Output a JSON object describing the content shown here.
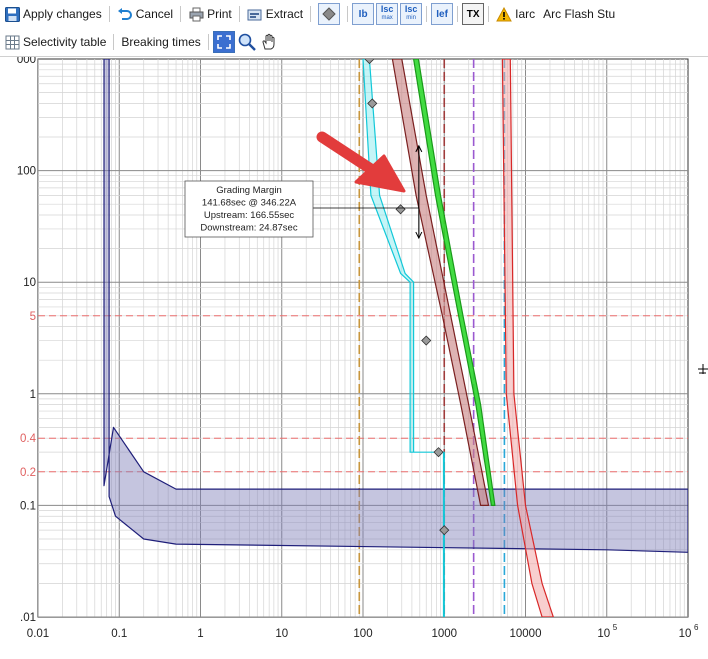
{
  "toolbar": {
    "apply_label": "Apply changes",
    "cancel_label": "Cancel",
    "print_label": "Print",
    "extract_label": "Extract",
    "ib_label": "Ib",
    "isc_label": "Isc",
    "isc_max_sub": "max",
    "isc_min_sub": "min",
    "ief_label": "Ief",
    "tx_label": "TX",
    "iarc_label": "Iarc",
    "arcflash_label": "Arc Flash Stu",
    "selectivity_label": "Selectivity table",
    "breaking_label": "Breaking times"
  },
  "icons": [
    "save-icon",
    "undo-icon",
    "printer-icon",
    "extract-icon",
    "diamond-icon",
    "warning-icon",
    "grid-table-icon",
    "zoom-extents-icon",
    "zoom-magnifier-icon",
    "pan-hand-icon"
  ],
  "chart_data": {
    "type": "line",
    "xscale": "log",
    "yscale": "log",
    "xlim": [
      0.01,
      1000000
    ],
    "ylim": [
      0.01,
      1000
    ],
    "grid": true,
    "x_tick_labels": [
      "0.01",
      "0.1",
      "1",
      "10",
      "100",
      "1000",
      "10000",
      "10^5",
      "10^6"
    ],
    "y_tick_labels": [
      "000",
      "100",
      "10",
      "5",
      "1",
      "0.4",
      "0.2",
      "0.1",
      ".01"
    ],
    "reference_lines": {
      "horizontal": [
        5,
        0.4,
        0.2
      ],
      "vertical": [
        {
          "x": 90,
          "color": "#c8963c",
          "style": "dashed"
        },
        {
          "x": 1000,
          "color": "#a03c3c",
          "style": "dashed"
        },
        {
          "x": 2300,
          "color": "#9b59d0",
          "style": "dashed"
        },
        {
          "x": 5500,
          "color": "#29a8d8",
          "style": "dashed"
        }
      ]
    },
    "series": [
      {
        "fill": "#7f7fb8",
        "stroke": "#1f1f7a",
        "opacity": 0.45,
        "upper": [
          [
            0.065,
            1000
          ],
          [
            0.065,
            0.15
          ],
          [
            0.085,
            0.5
          ],
          [
            0.2,
            0.2
          ],
          [
            0.5,
            0.14
          ],
          [
            1000000,
            0.14
          ]
        ],
        "lower": [
          [
            0.075,
            1000
          ],
          [
            0.075,
            0.12
          ],
          [
            0.09,
            0.08
          ],
          [
            0.2,
            0.05
          ],
          [
            0.5,
            0.045
          ],
          [
            100000,
            0.04
          ],
          [
            1000000,
            0.038
          ]
        ]
      },
      {
        "fill": "#7fe8ee",
        "stroke": "#12c8d8",
        "opacity": 0.45,
        "upper": [
          [
            120,
            1000
          ],
          [
            160,
            60
          ],
          [
            330,
            12
          ],
          [
            420,
            10
          ],
          [
            420,
            0.3
          ],
          [
            1000,
            0.3
          ],
          [
            1000,
            0.01
          ]
        ],
        "lower": [
          [
            100,
            1000
          ],
          [
            125,
            60
          ],
          [
            290,
            12
          ],
          [
            380,
            10
          ],
          [
            380,
            0.3
          ],
          [
            980,
            0.3
          ],
          [
            980,
            0.01
          ]
        ]
      },
      {
        "fill": "#c88080",
        "stroke": "#7a2020",
        "opacity": 0.6,
        "upper": [
          [
            300,
            1000
          ],
          [
            600,
            60
          ],
          [
            1200,
            5
          ],
          [
            2000,
            0.8
          ],
          [
            3500,
            0.1
          ]
        ],
        "lower": [
          [
            230,
            1000
          ],
          [
            450,
            60
          ],
          [
            950,
            5
          ],
          [
            1600,
            0.8
          ],
          [
            2800,
            0.1
          ]
        ]
      },
      {
        "fill": "#2ed82e",
        "stroke": "#1a9a1a",
        "opacity": 0.9,
        "upper": [
          [
            480,
            1000
          ],
          [
            900,
            60
          ],
          [
            1700,
            5
          ],
          [
            2800,
            0.8
          ],
          [
            4200,
            0.1
          ]
        ],
        "lower": [
          [
            420,
            1000
          ],
          [
            780,
            60
          ],
          [
            1500,
            5
          ],
          [
            2450,
            0.8
          ],
          [
            3800,
            0.1
          ]
        ]
      },
      {
        "fill": "#f2a8a8",
        "stroke": "#d82828",
        "opacity": 0.55,
        "upper": [
          [
            6500,
            1000
          ],
          [
            7200,
            1
          ],
          [
            10000,
            0.1
          ],
          [
            16000,
            0.02
          ],
          [
            22000,
            0.01
          ]
        ],
        "lower": [
          [
            5200,
            1000
          ],
          [
            5800,
            1
          ],
          [
            8000,
            0.1
          ],
          [
            12000,
            0.02
          ],
          [
            16000,
            0.01
          ]
        ]
      }
    ],
    "markers": [
      [
        120,
        1000
      ],
      [
        130,
        400
      ],
      [
        290,
        45
      ],
      [
        600,
        3
      ],
      [
        850,
        0.3
      ],
      [
        1000,
        0.06
      ]
    ],
    "grading_margin": {
      "x": 346.22,
      "upper_t": 166.55,
      "lower_t": 24.87,
      "lines": [
        "Grading Margin",
        "141.68sec @ 346.22A",
        "Upstream: 166.55sec",
        "Downstream: 24.87sec"
      ]
    }
  }
}
